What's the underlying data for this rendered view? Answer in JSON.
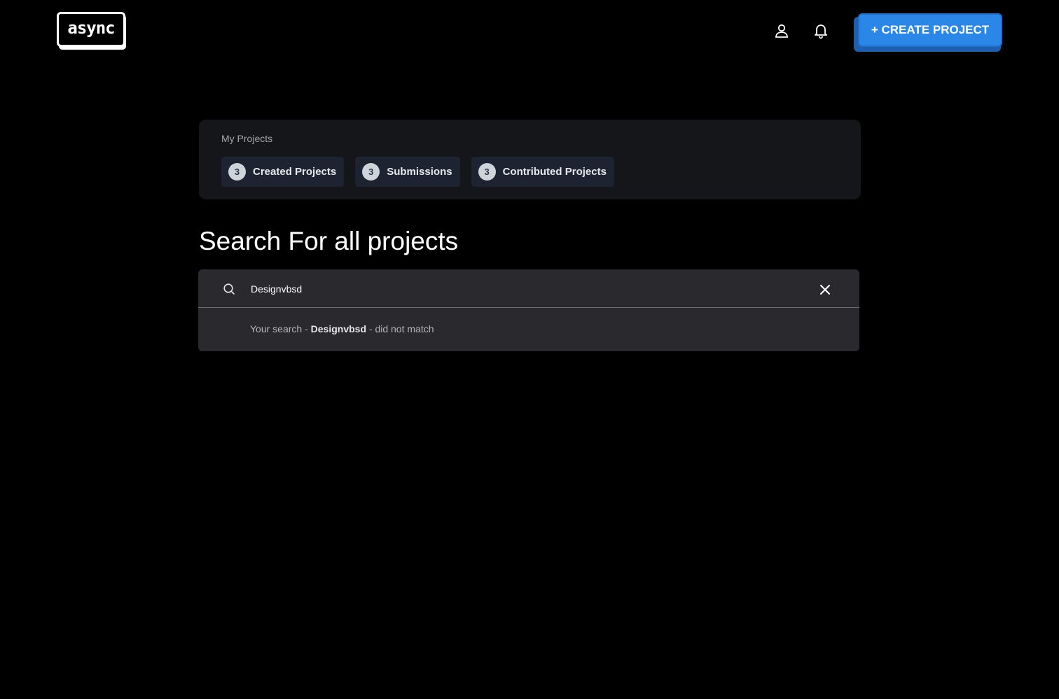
{
  "header": {
    "logo_text": "async",
    "create_button_label": "+ CREATE PROJECT",
    "icons": [
      "user-icon",
      "bell-icon"
    ]
  },
  "my_projects": {
    "label": "My Projects",
    "chips": [
      {
        "count": "3",
        "label": "Created Projects"
      },
      {
        "count": "3",
        "label": "Submissions"
      },
      {
        "count": "3",
        "label": "Contributed Projects"
      }
    ]
  },
  "search": {
    "title": "Search For all projects",
    "value": "Designvbsd",
    "result_prefix": "Your search - ",
    "result_term": "Designvbsd",
    "result_suffix": " - did not match",
    "icons": [
      "search-icon",
      "close-icon"
    ]
  },
  "colors": {
    "background": "#000000",
    "accent": "#2a87e8",
    "card": "#151619",
    "search_panel": "#29292e"
  }
}
